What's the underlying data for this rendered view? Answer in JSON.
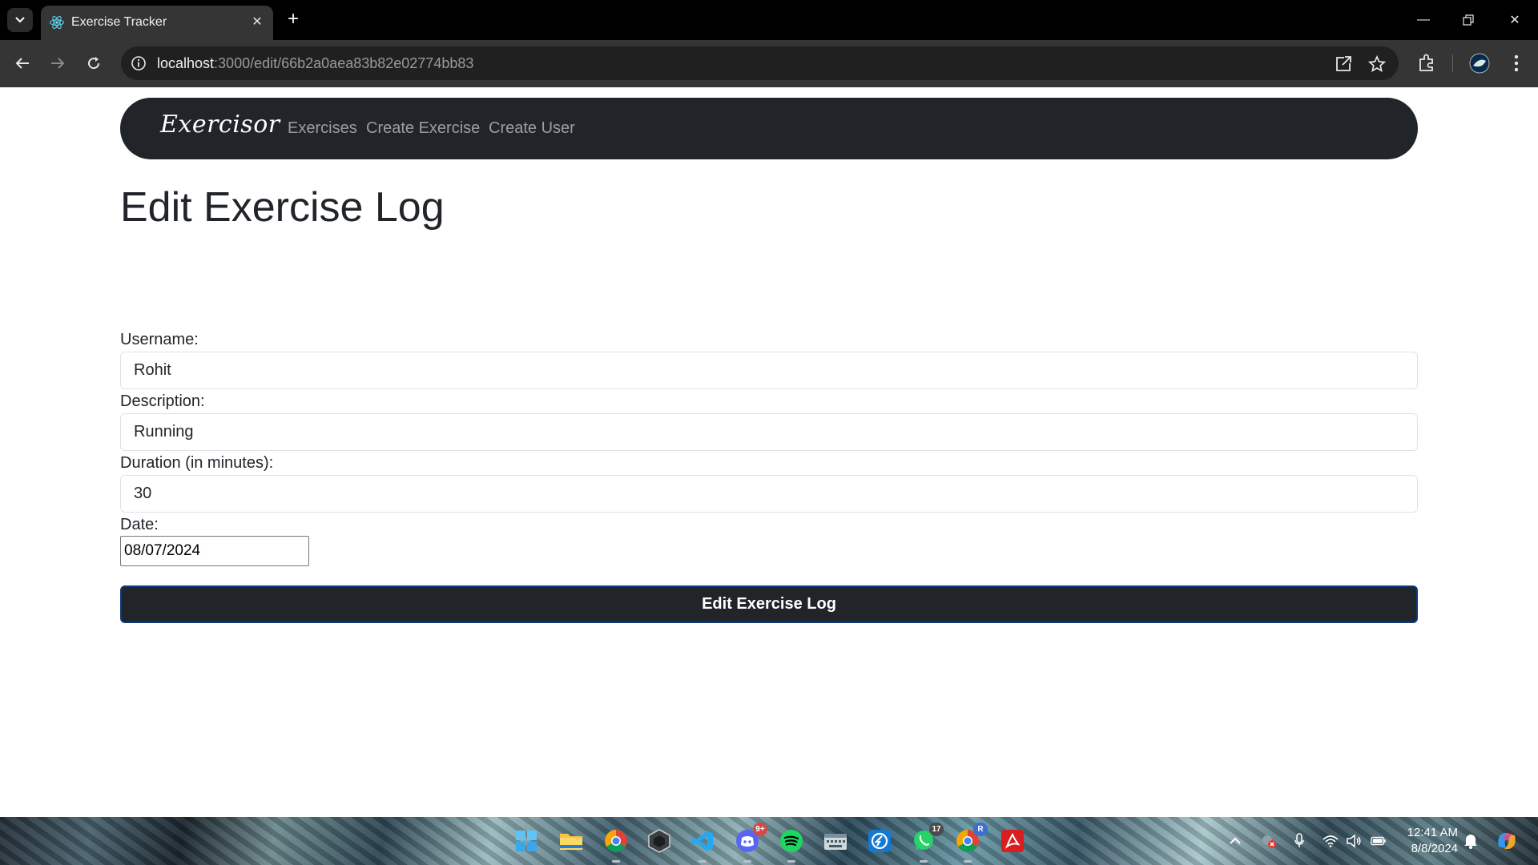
{
  "browser": {
    "tab_title": "Exercise Tracker",
    "url_host": "localhost",
    "url_path": ":3000/edit/66b2a0aea83b82e02774bb83"
  },
  "navbar": {
    "brand": "Exercisor",
    "links": [
      "Exercises",
      "Create Exercise",
      "Create User"
    ]
  },
  "form": {
    "title": "Edit Exercise Log",
    "username_label": "Username:",
    "username_value": "Rohit",
    "description_label": "Description:",
    "description_value": "Running",
    "duration_label": "Duration (in minutes):",
    "duration_value": "30",
    "date_label": "Date:",
    "date_value": "08/07/2024",
    "submit_label": "Edit Exercise Log"
  },
  "taskbar": {
    "apps": [
      "start",
      "file-explorer",
      "chrome-dev",
      "unity",
      "vscode",
      "discord",
      "spotify",
      "keyboard-app",
      "app-shortcut",
      "whatsapp",
      "chrome-profile",
      "acrobat"
    ],
    "discord_badge": "9+",
    "whatsapp_badge": "17",
    "chrome_profile_badge": "R",
    "clock_time": "12:41 AM",
    "clock_date": "8/8/2024"
  },
  "colors": {
    "navbar_bg": "#212529",
    "button_bg": "#212529",
    "button_border": "#0d3b7a"
  }
}
